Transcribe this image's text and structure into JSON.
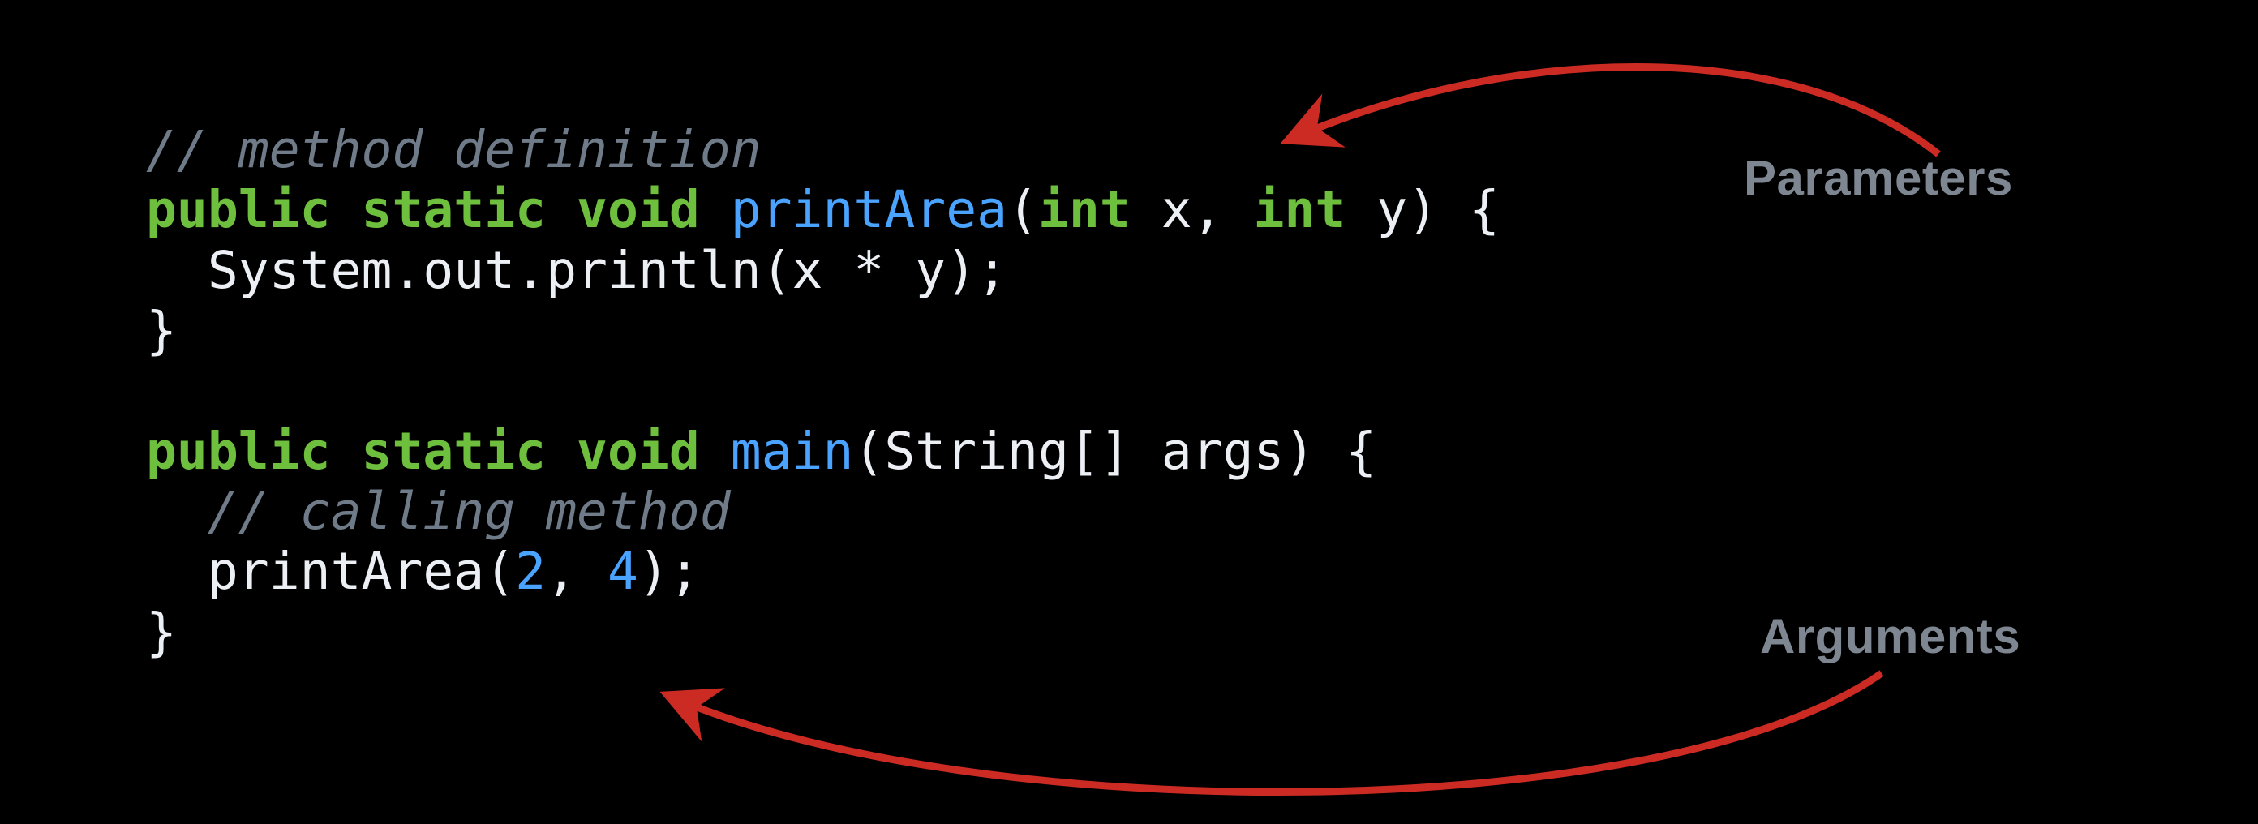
{
  "code": {
    "line1_comment": "// method definition",
    "line2_kw1": "public",
    "line2_kw2": "static",
    "line2_kw3": "void",
    "line2_method": "printArea",
    "line2_paren_open": "(",
    "line2_type1": "int",
    "line2_p1": " x",
    "line2_comma": ", ",
    "line2_type2": "int",
    "line2_p2": " y",
    "line2_paren_close_brace": ") {",
    "line3_indent": "  ",
    "line3_body": "System.out.println(x * y);",
    "line4_close": "}",
    "blank": "",
    "line6_kw1": "public",
    "line6_kw2": "static",
    "line6_kw3": "void",
    "line6_method": "main",
    "line6_paren_open": "(",
    "line6_argtype": "String[]",
    "line6_argname": " args",
    "line6_paren_close_brace": ") {",
    "line7_indent": "  ",
    "line7_comment": "// calling method",
    "line8_indent": "  ",
    "line8_call": "printArea",
    "line8_paren_open": "(",
    "line8_arg1": "2",
    "line8_comma": ", ",
    "line8_arg2": "4",
    "line8_paren_close_semi": ");",
    "line9_close": "}"
  },
  "labels": {
    "parameters": "Parameters",
    "arguments": "Arguments"
  },
  "colors": {
    "background": "#000000",
    "comment": "#6f7b88",
    "keyword": "#6fbf3e",
    "method": "#4aa3ff",
    "text": "#eceff4",
    "label": "#7e8791",
    "arrow": "#cc2b24"
  }
}
